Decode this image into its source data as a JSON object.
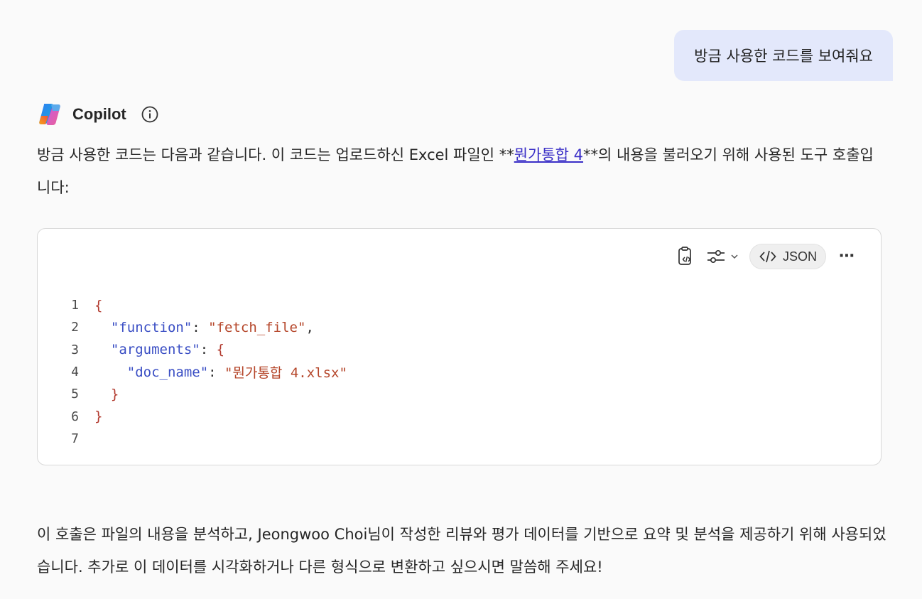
{
  "user_message": "방금 사용한 코드를 보여줘요",
  "assistant": {
    "name": "Copilot",
    "icon": "copilot-logo-icon",
    "info_icon": "info-icon",
    "intro_before_link": "방금 사용한 코드는 다음과 같습니다. 이 코드는 업로드하신 Excel 파일인 **",
    "link_text": "뭔가통합 4",
    "intro_after_link": "**의 내용을 불러오기 위해 사용된 도구 호출입니다:",
    "closing": "이 호출은 파일의 내용을 분석하고, Jeongwoo Choi님이 작성한 리뷰와 평가 데이터를 기반으로 요약 및 분석을 제공하기 위해 사용되었습니다. 추가로 이 데이터를 시각화하거나 다른 형식으로 변환하고 싶으시면 말씀해 주세요!"
  },
  "code_block": {
    "language": "JSON",
    "toolbar": {
      "copy_icon": "clipboard-code-icon",
      "settings_icon": "sliders-icon",
      "dropdown_icon": "chevron-down-icon",
      "lang_icon": "code-brackets-icon",
      "more_icon": "more-horizontal-icon",
      "more_label": "⋯"
    },
    "line_numbers": [
      "1",
      "2",
      "3",
      "4",
      "5",
      "6",
      "7"
    ],
    "tokens": {
      "open_brace": "{",
      "close_brace": "}",
      "key_function": "\"function\"",
      "val_function": "\"fetch_file\"",
      "key_arguments": "\"arguments\"",
      "key_doc_name": "\"doc_name\"",
      "val_doc_name": "\"뭔가통합 4.xlsx\"",
      "colon": ": ",
      "comma": ","
    }
  },
  "colors": {
    "user_bubble": "#e3e8fb",
    "link": "#3a2fc7",
    "json_key": "#3a4ec4",
    "json_string": "#b5462a",
    "json_brace": "#b23a2e"
  }
}
